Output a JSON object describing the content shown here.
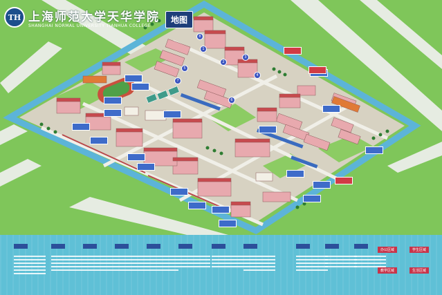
{
  "header": {
    "logo_text": "TH",
    "title_cn": "上海师范大学天华学院",
    "title_en": "SHANGHAI NORMAL UNIVERSITY TIANHUA COLLEGE",
    "map_badge": "地图"
  },
  "colors": {
    "grass": "#7fc65a",
    "road": "#dfe7dc",
    "canal": "#5cb4d8",
    "campus_ground": "#d9d4c4",
    "building_pink": "#e7a2a9",
    "building_roof": "#c74a4e",
    "label_blue": "#3e6bc9",
    "label_red": "#d13b45",
    "legend_bg": "#5fc0d6"
  },
  "map": {
    "building_numbers": [
      "1",
      "2",
      "3",
      "4",
      "5",
      "6",
      "7",
      "8"
    ]
  },
  "legend": {
    "red_tags": [
      "办公区域",
      "学生区域",
      "教学区域",
      "生活区域"
    ]
  }
}
